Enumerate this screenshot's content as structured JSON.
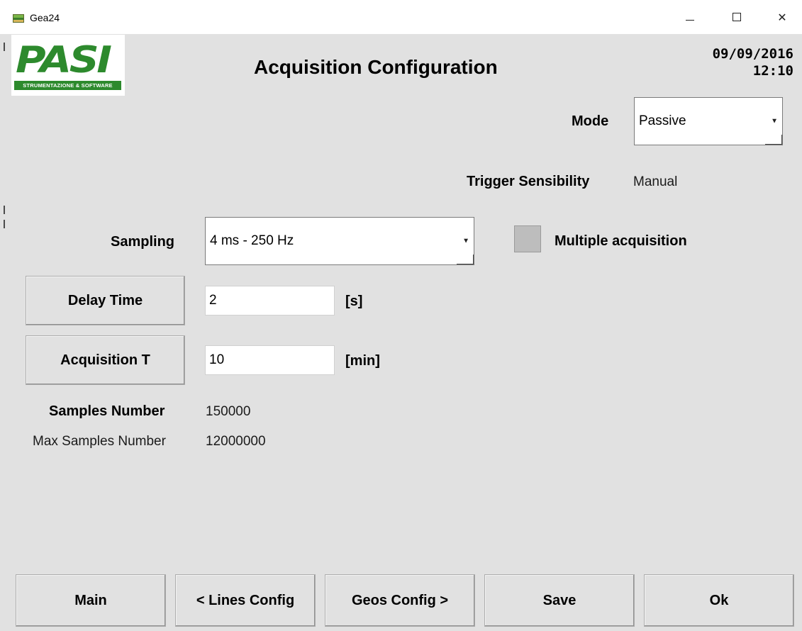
{
  "window": {
    "title": "Gea24"
  },
  "logo": {
    "letters": "PASI",
    "tagline": "STRUMENTAZIONE & SOFTWARE"
  },
  "header": {
    "title": "Acquisition Configuration",
    "date": "09/09/2016",
    "time": "12:10"
  },
  "mode": {
    "label": "Mode",
    "value": "Passive"
  },
  "trigger": {
    "label": "Trigger Sensibility",
    "value": "Manual"
  },
  "sampling": {
    "label": "Sampling",
    "value": "4 ms - 250 Hz"
  },
  "multiple_acquisition": {
    "label": "Multiple acquisition"
  },
  "delay": {
    "button_label": "Delay Time",
    "value": "2",
    "unit": "[s]"
  },
  "acquisition": {
    "button_label": "Acquisition T",
    "value": "10",
    "unit": "[min]"
  },
  "samples": {
    "label": "Samples Number",
    "value": "150000"
  },
  "max_samples": {
    "label": "Max Samples Number",
    "value": "12000000"
  },
  "footer": {
    "main": "Main",
    "lines_config": "< Lines Config",
    "geos_config": "Geos Config >",
    "save": "Save",
    "ok": "Ok"
  }
}
